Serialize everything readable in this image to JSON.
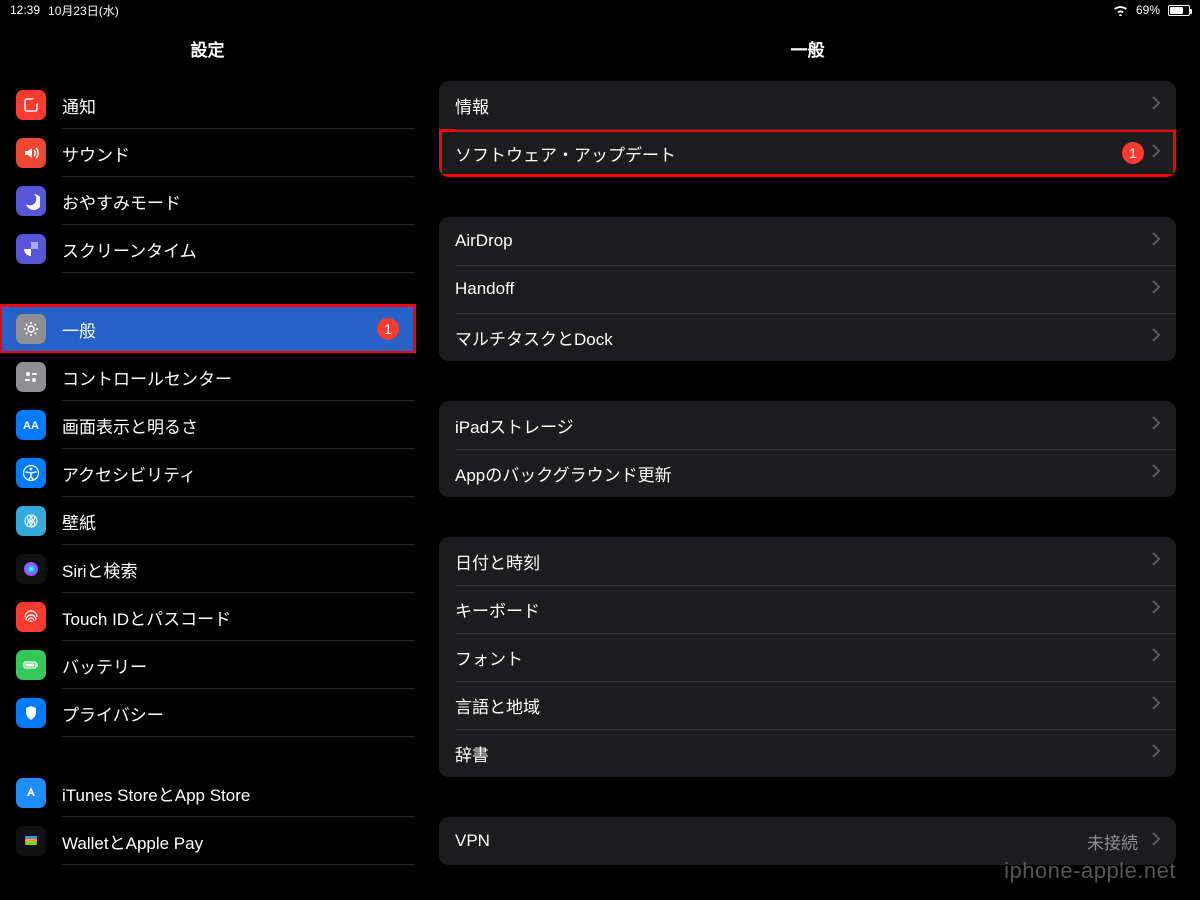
{
  "status": {
    "time": "12:39",
    "date": "10月23日(水)",
    "battery_pct": "69%"
  },
  "sidebar": {
    "title": "設定",
    "items": [
      {
        "id": "notifications",
        "label": "通知"
      },
      {
        "id": "sounds",
        "label": "サウンド"
      },
      {
        "id": "dnd",
        "label": "おやすみモード"
      },
      {
        "id": "screentime",
        "label": "スクリーンタイム"
      },
      {
        "id": "general",
        "label": "一般",
        "badge": "1",
        "selected": true,
        "highlight": true
      },
      {
        "id": "control-center",
        "label": "コントロールセンター"
      },
      {
        "id": "display",
        "label": "画面表示と明るさ"
      },
      {
        "id": "accessibility",
        "label": "アクセシビリティ"
      },
      {
        "id": "wallpaper",
        "label": "壁紙"
      },
      {
        "id": "siri",
        "label": "Siriと検索"
      },
      {
        "id": "touchid",
        "label": "Touch IDとパスコード"
      },
      {
        "id": "battery",
        "label": "バッテリー"
      },
      {
        "id": "privacy",
        "label": "プライバシー"
      },
      {
        "id": "appstore",
        "label": "iTunes StoreとApp Store"
      },
      {
        "id": "wallet",
        "label": "WalletとApple Pay"
      }
    ]
  },
  "detail": {
    "title": "一般",
    "groups": [
      [
        {
          "id": "about",
          "label": "情報"
        },
        {
          "id": "software-update",
          "label": "ソフトウェア・アップデート",
          "badge": "1",
          "highlight": true
        }
      ],
      [
        {
          "id": "airdrop",
          "label": "AirDrop"
        },
        {
          "id": "handoff",
          "label": "Handoff"
        },
        {
          "id": "multitask",
          "label": "マルチタスクとDock"
        }
      ],
      [
        {
          "id": "storage",
          "label": "iPadストレージ"
        },
        {
          "id": "bg-refresh",
          "label": "Appのバックグラウンド更新"
        }
      ],
      [
        {
          "id": "datetime",
          "label": "日付と時刻"
        },
        {
          "id": "keyboard",
          "label": "キーボード"
        },
        {
          "id": "fonts",
          "label": "フォント"
        },
        {
          "id": "language",
          "label": "言語と地域"
        },
        {
          "id": "dictionary",
          "label": "辞書"
        }
      ],
      [
        {
          "id": "vpn",
          "label": "VPN",
          "value": "未接続"
        }
      ]
    ]
  },
  "watermark": "iphone-apple.net"
}
